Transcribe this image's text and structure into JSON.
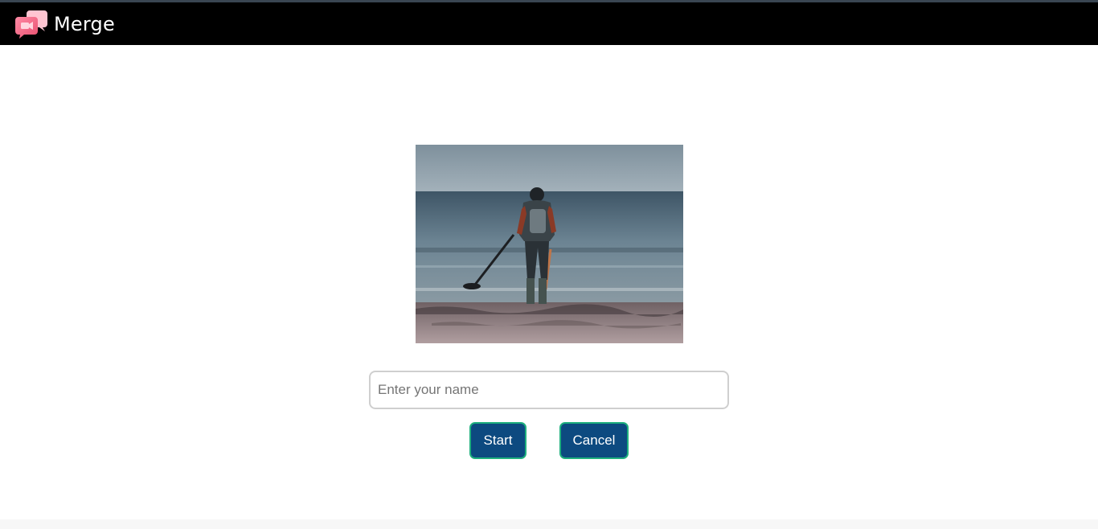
{
  "app": {
    "name": "Merge",
    "logo_icon": "chat-bubbles-icon"
  },
  "hero_image": {
    "icon": "beach-metal-detector-photo"
  },
  "form": {
    "name_placeholder": "Enter your name",
    "name_value": ""
  },
  "actions": {
    "start_label": "Start",
    "cancel_label": "Cancel"
  },
  "colors": {
    "header_bg": "#000000",
    "button_bg": "#0d4a80",
    "button_border": "#1fb07e",
    "logo_pink": "#f06e8e"
  }
}
